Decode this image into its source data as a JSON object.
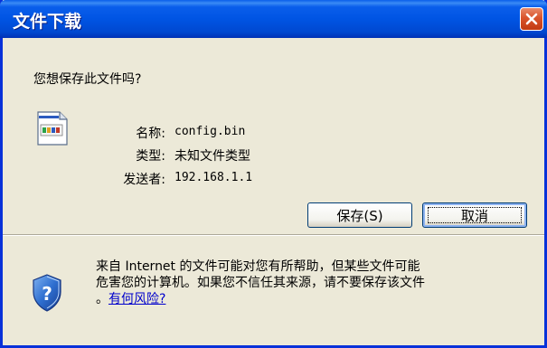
{
  "window": {
    "title": "文件下载"
  },
  "dialog": {
    "question": "您想保存此文件吗?",
    "fields": [
      {
        "label": "名称:",
        "value": "config.bin"
      },
      {
        "label": "类型:",
        "value": "未知文件类型"
      },
      {
        "label": "发送者:",
        "value": "192.168.1.1"
      }
    ],
    "save_label": "保存(S)",
    "cancel_label": "取消"
  },
  "warning": {
    "line1": "来自 Internet 的文件可能对您有所帮助，但某些文件可能",
    "line2": "危害您的计算机。如果您不信任其来源，请不要保存该文件",
    "line3_prefix": "。",
    "link_text": "有何风险?"
  },
  "colors": {
    "titlebar": "#0054E3",
    "window_bg": "#ECE9D8",
    "close_button": "#D9532B",
    "link": "#0000CC"
  },
  "icons": {
    "file": "unknown-file-icon",
    "close": "close-icon",
    "security": "shield-question-icon"
  }
}
